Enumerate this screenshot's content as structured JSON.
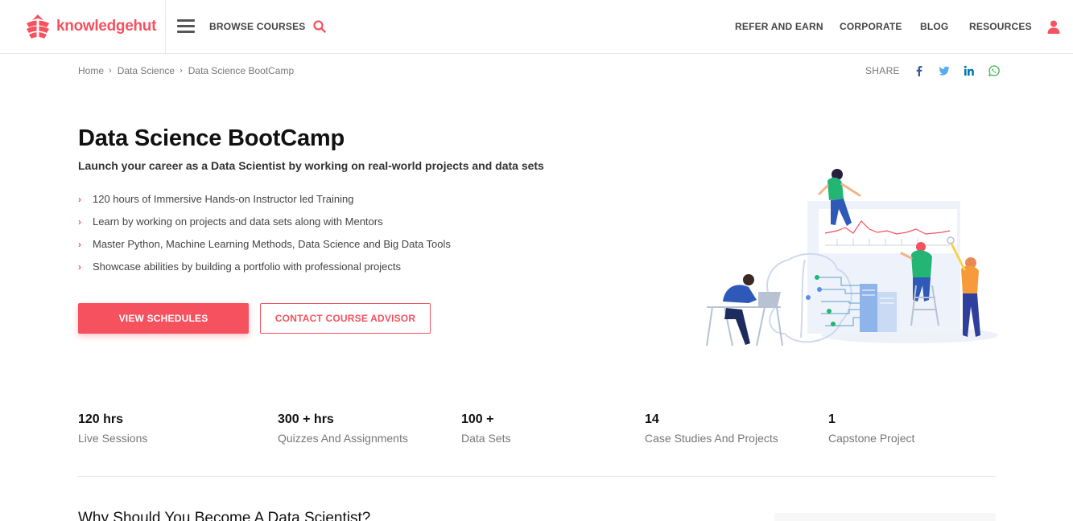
{
  "header": {
    "logo_text": "knowledgehut",
    "browse_label": "BROWSE COURSES",
    "nav": [
      "REFER AND EARN",
      "CORPORATE",
      "BLOG",
      "RESOURCES"
    ],
    "brand_color": "#f5515f"
  },
  "breadcrumb": {
    "items": [
      "Home",
      "Data Science",
      "Data Science BootCamp"
    ]
  },
  "share": {
    "label": "SHARE",
    "icons": [
      "facebook-icon",
      "twitter-icon",
      "linkedin-icon",
      "whatsapp-icon"
    ]
  },
  "hero": {
    "title": "Data Science BootCamp",
    "subtitle": "Launch your career as a Data Scientist by working on real-world projects and data sets",
    "features": [
      "120 hours of Immersive Hands-on Instructor led Training",
      "Learn by working on projects and data sets along with Mentors",
      "Master Python, Machine Learning Methods, Data Science and Big Data Tools",
      "Showcase abilities by building a portfolio with professional projects"
    ],
    "primary_button": "VIEW SCHEDULES",
    "secondary_button": "CONTACT COURSE ADVISOR"
  },
  "stats": [
    {
      "value": "120 hrs",
      "label": "Live Sessions"
    },
    {
      "value": "300 + hrs",
      "label": "Quizzes And Assignments"
    },
    {
      "value": "100 +",
      "label": "Data Sets"
    },
    {
      "value": "14",
      "label": "Case Studies And Projects"
    },
    {
      "value": "1",
      "label": "Capstone Project"
    }
  ],
  "section": {
    "title": "Why Should You Become A Data Scientist?"
  }
}
